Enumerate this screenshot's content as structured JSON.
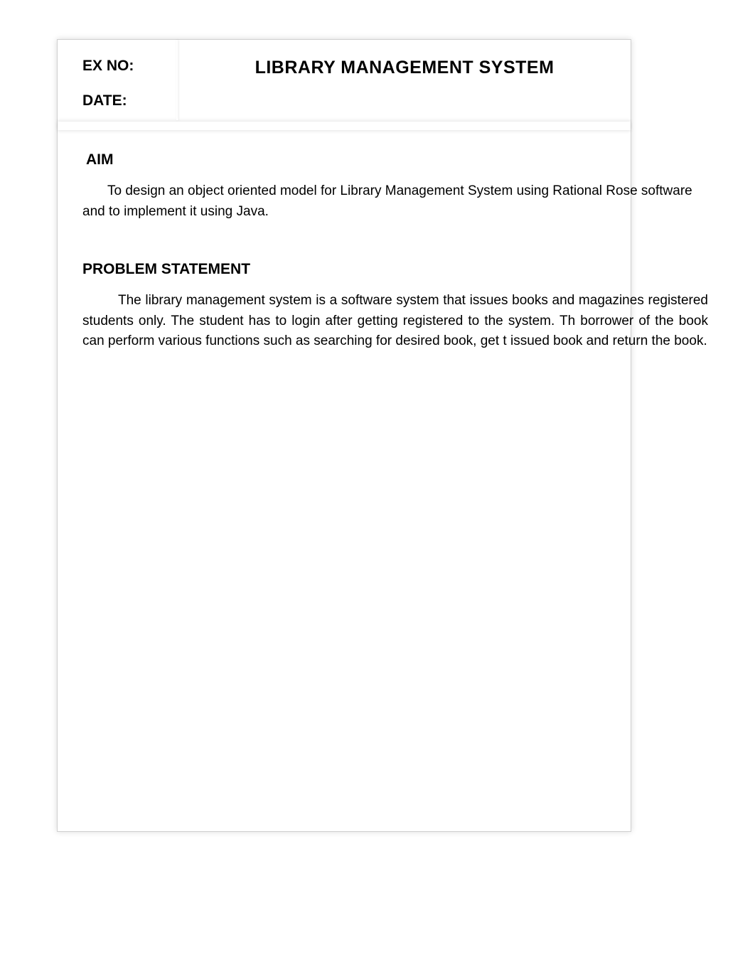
{
  "header": {
    "ex_no_label": "EX NO:",
    "date_label": "DATE:",
    "title": "LIBRARY MANAGEMENT SYSTEM"
  },
  "sections": {
    "aim": {
      "heading": "AIM",
      "text": "To design an object oriented model for Library Management System using Rational Rose software and to implement it using Java."
    },
    "problem_statement": {
      "heading": "PROBLEM STATEMENT",
      "text": "The library management system is a software system that issues books and magazines registered students only. The student has to login after getting registered to the system. Th borrower of the book can perform various functions such as searching for desired book, get t issued book and return the book."
    }
  }
}
